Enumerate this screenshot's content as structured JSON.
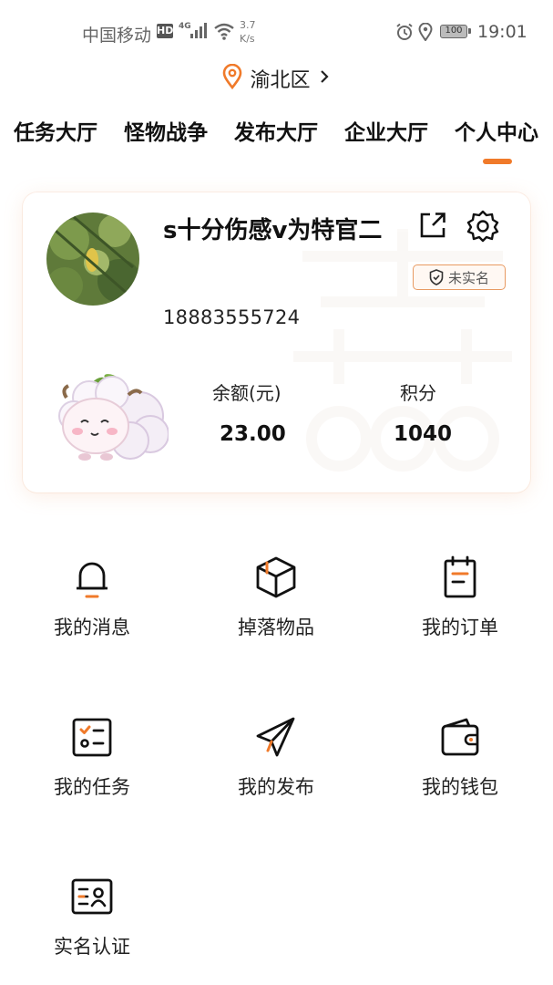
{
  "status_bar": {
    "carrier": "中国移动",
    "hd": "HD",
    "network": "4G",
    "speed_value": "3.7",
    "speed_unit": "K/s",
    "battery": "100",
    "time": "19:01"
  },
  "location": {
    "label": "渝北区"
  },
  "tabs": [
    {
      "label": "任务大厅"
    },
    {
      "label": "怪物战争"
    },
    {
      "label": "发布大厅"
    },
    {
      "label": "企业大厅"
    },
    {
      "label": "个人中心"
    }
  ],
  "active_tab": "个人中心",
  "profile": {
    "nickname": "s十分伤感v为特官二",
    "verify_status": "未实名",
    "phone": "18883555724",
    "balance_label": "余额(元)",
    "balance_value": "23.00",
    "points_label": "积分",
    "points_value": "1040"
  },
  "menu": [
    {
      "label": "我的消息",
      "icon": "bell-icon"
    },
    {
      "label": "掉落物品",
      "icon": "box-icon"
    },
    {
      "label": "我的订单",
      "icon": "order-icon"
    },
    {
      "label": "我的任务",
      "icon": "task-list-icon"
    },
    {
      "label": "我的发布",
      "icon": "paper-plane-icon"
    },
    {
      "label": "我的钱包",
      "icon": "wallet-icon"
    },
    {
      "label": "实名认证",
      "icon": "id-card-icon"
    }
  ],
  "colors": {
    "accent": "#f07a2a",
    "text": "#111111",
    "badge_border": "#e89a62"
  }
}
